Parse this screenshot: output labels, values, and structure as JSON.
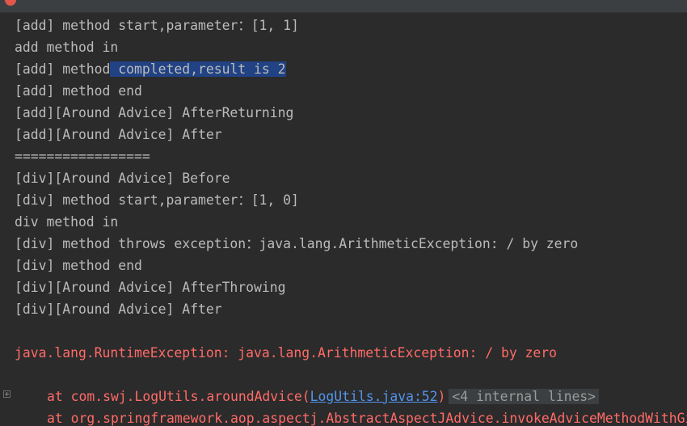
{
  "colors": {
    "background": "#2b2b2b",
    "text": "#bbbbbb",
    "error": "#ff6b68",
    "link": "#5394ec",
    "selection": "#214283"
  },
  "console": {
    "lines": [
      "[add] method start,parameter：[1, 1]",
      "add method in",
      "[add] method",
      "[add] method end",
      "[add][Around Advice] AfterReturning",
      "[add][Around Advice] After",
      "=================",
      "[div][Around Advice] Before",
      "[div] method start,parameter：[1, 0]",
      "div method in",
      "[div] method throws exception：java.lang.ArithmeticException: / by zero",
      "[div] method end",
      "[div][Around Advice] AfterThrowing",
      "[div][Around Advice] After"
    ],
    "selected_text": " completed,result is 2",
    "exception": "java.lang.RuntimeException: java.lang.ArithmeticException: / by zero",
    "stack": {
      "frame1_prefix": "at com.swj.LogUtils.aroundAdvice(",
      "frame1_link": "LogUtils.java:52",
      "frame1_suffix": ")",
      "folded_label": "<4 internal lines>",
      "frame2": "at org.springframework.aop.aspectj.AbstractAspectJAdvice.invokeAdviceMethodWithGivenArgs"
    }
  }
}
